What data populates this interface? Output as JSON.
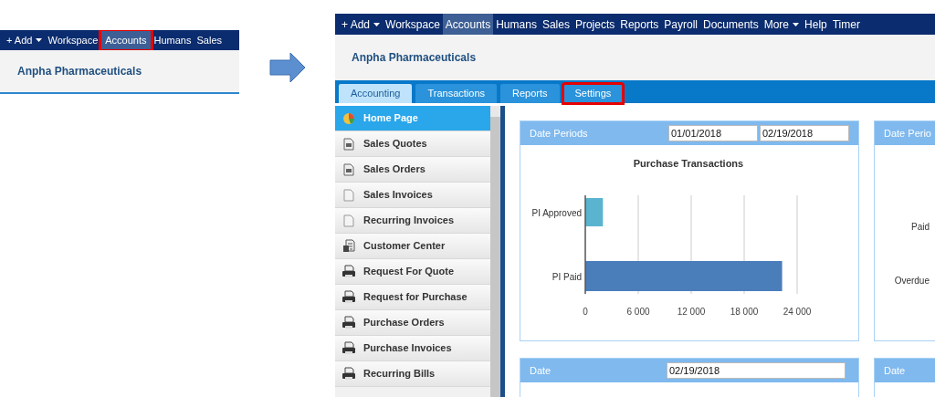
{
  "before": {
    "nav": [
      {
        "label": "+ Add",
        "dropdown": true,
        "selected": false,
        "highlighted": false
      },
      {
        "label": "Workspace",
        "dropdown": false,
        "selected": false,
        "highlighted": false
      },
      {
        "label": "Accounts",
        "dropdown": false,
        "selected": true,
        "highlighted": true
      },
      {
        "label": "Humans",
        "dropdown": false,
        "selected": false,
        "highlighted": false
      },
      {
        "label": "Sales",
        "dropdown": false,
        "selected": false,
        "highlighted": false
      }
    ],
    "company": "Anpha Pharmaceuticals"
  },
  "after": {
    "nav": [
      {
        "label": "+ Add",
        "dropdown": true,
        "selected": false,
        "highlighted": false
      },
      {
        "label": "Workspace",
        "dropdown": false,
        "selected": false,
        "highlighted": false
      },
      {
        "label": "Accounts",
        "dropdown": false,
        "selected": true,
        "highlighted": false
      },
      {
        "label": "Humans",
        "dropdown": false,
        "selected": false,
        "highlighted": false
      },
      {
        "label": "Sales",
        "dropdown": false,
        "selected": false,
        "highlighted": false
      },
      {
        "label": "Projects",
        "dropdown": false,
        "selected": false,
        "highlighted": false
      },
      {
        "label": "Reports",
        "dropdown": false,
        "selected": false,
        "highlighted": false
      },
      {
        "label": "Payroll",
        "dropdown": false,
        "selected": false,
        "highlighted": false
      },
      {
        "label": "Documents",
        "dropdown": false,
        "selected": false,
        "highlighted": false
      },
      {
        "label": "More",
        "dropdown": true,
        "selected": false,
        "highlighted": false
      },
      {
        "label": "Help",
        "dropdown": false,
        "selected": false,
        "highlighted": false
      },
      {
        "label": "Timer",
        "dropdown": false,
        "selected": false,
        "highlighted": false
      }
    ],
    "company": "Anpha Pharmaceuticals",
    "tabs": [
      {
        "label": "Accounting",
        "selected": true,
        "highlighted": false
      },
      {
        "label": "Transactions",
        "selected": false,
        "highlighted": false
      },
      {
        "label": "Reports",
        "selected": false,
        "highlighted": false
      },
      {
        "label": "Settings",
        "selected": false,
        "highlighted": true
      }
    ],
    "sidebar": {
      "items": [
        {
          "label": "Home Page",
          "kind": "home",
          "selected": true
        },
        {
          "label": "Sales Quotes",
          "kind": "form",
          "selected": false
        },
        {
          "label": "Sales Orders",
          "kind": "form",
          "selected": false
        },
        {
          "label": "Sales Invoices",
          "kind": "page",
          "selected": false
        },
        {
          "label": "Recurring Invoices",
          "kind": "page",
          "selected": false
        },
        {
          "label": "Customer Center",
          "kind": "center",
          "selected": false
        },
        {
          "label": "Request For Quote",
          "kind": "printer",
          "selected": false
        },
        {
          "label": "Request for Purchase",
          "kind": "printer",
          "selected": false
        },
        {
          "label": "Purchase Orders",
          "kind": "printer",
          "selected": false
        },
        {
          "label": "Purchase Invoices",
          "kind": "printer",
          "selected": false
        },
        {
          "label": "Recurring Bills",
          "kind": "printer",
          "selected": false
        }
      ]
    },
    "panels": [
      {
        "header": "Date Periods",
        "from": "01/01/2018",
        "to": "02/19/2018",
        "chart_data": {
          "type": "bar",
          "orientation": "horizontal",
          "title": "Purchase Transactions",
          "categories": [
            "PI Approved",
            "PI Paid"
          ],
          "series": [
            {
              "values": [
                2000,
                22300
              ]
            }
          ],
          "grid": true,
          "colors": [
            "#5ab4d0",
            "#4a7ebb"
          ],
          "xlim": [
            0,
            24000
          ],
          "xticks": [
            {
              "value": 0,
              "label": "0"
            },
            {
              "value": 6000,
              "label": "6 000"
            },
            {
              "value": 12000,
              "label": "12 000"
            },
            {
              "value": 18000,
              "label": "18 000"
            },
            {
              "value": 24000,
              "label": "24 000"
            }
          ]
        }
      },
      {
        "header": "Date Perio",
        "labels": [
          "Paid",
          "Overdue"
        ]
      }
    ],
    "bottom_panels": [
      {
        "header": "Date",
        "date": "02/19/2018"
      },
      {
        "header": "Date"
      }
    ]
  }
}
